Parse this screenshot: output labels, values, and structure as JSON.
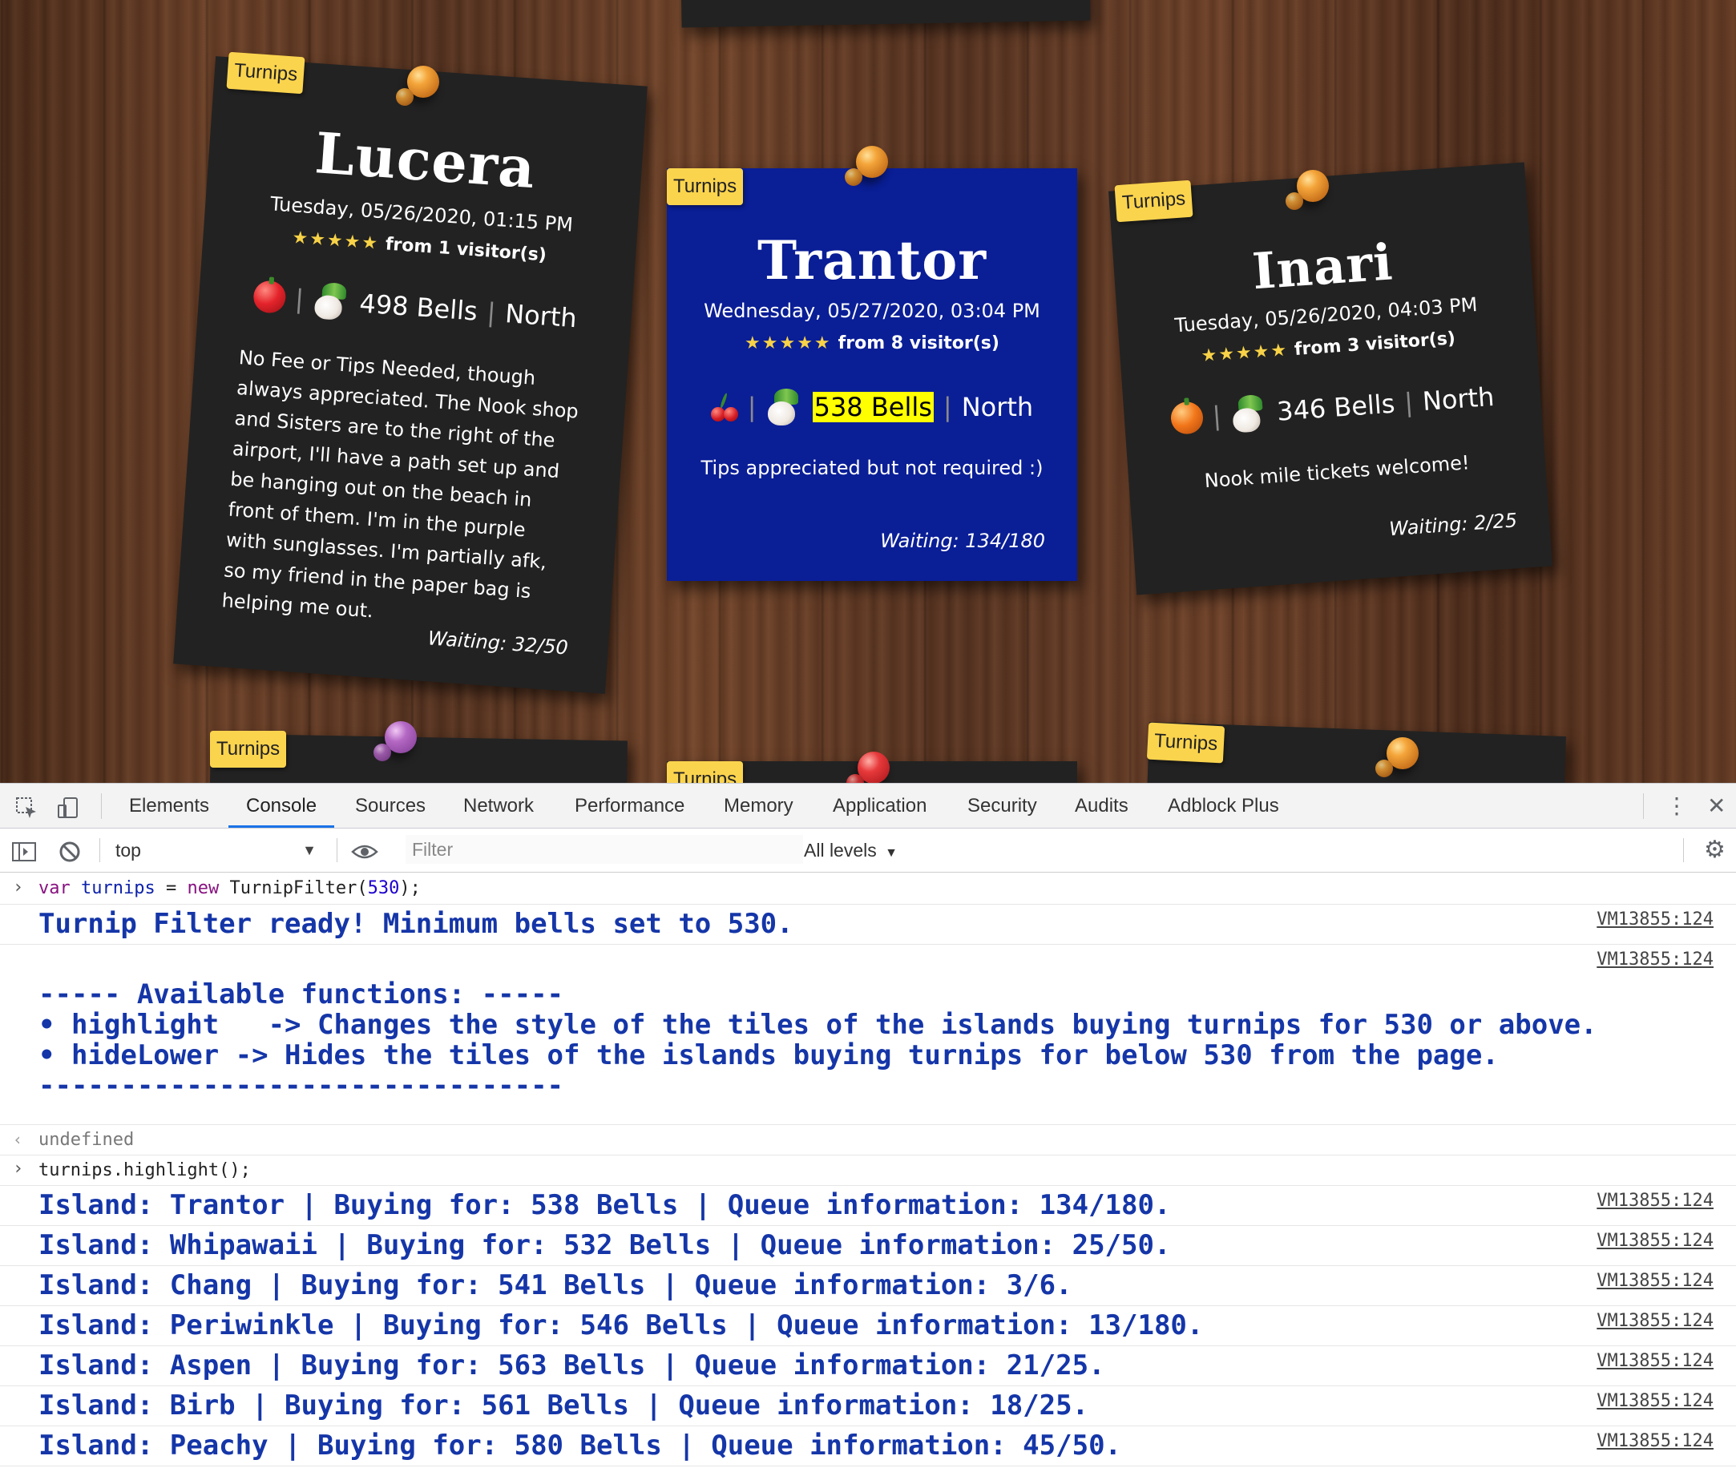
{
  "board": {
    "tiles": [
      {
        "tag": "Turnips",
        "name": "Lucera",
        "datetime": "Tuesday, 05/26/2020, 01:15 PM",
        "stars": "★★★★★",
        "visitors": "from 1 visitor(s)",
        "fruit": "apple",
        "bells": "498 Bells",
        "direction": "North",
        "description": "No Fee or Tips Needed, though always appreciated. The Nook shop and Sisters are to the right of the airport, I'll have a path set up and be hanging out on the beach in front of them. I'm in the purple with sunglasses. I'm partially afk, so my friend in the paper bag is helping me out.",
        "waiting": "Waiting: 32/50"
      },
      {
        "tag": "Turnips",
        "name": "Trantor",
        "datetime": "Wednesday, 05/27/2020, 03:04 PM",
        "stars": "★★★★★",
        "visitors": "from 8 visitor(s)",
        "fruit": "cherry",
        "bells": "538 Bells",
        "direction": "North",
        "description": "Tips appreciated but not required :)",
        "waiting": "Waiting: 134/180",
        "highlighted": true
      },
      {
        "tag": "Turnips",
        "name": "Inari",
        "datetime": "Tuesday, 05/26/2020, 04:03 PM",
        "stars": "★★★★★",
        "visitors": "from 3 visitor(s)",
        "fruit": "orange",
        "bells": "346 Bells",
        "direction": "North",
        "description": "Nook mile tickets welcome!",
        "waiting": "Waiting: 2/25"
      }
    ],
    "lower_tags": [
      "Turnips",
      "Turnips",
      "Turnips"
    ]
  },
  "devtools": {
    "tabs": [
      "Elements",
      "Console",
      "Sources",
      "Network",
      "Performance",
      "Memory",
      "Application",
      "Security",
      "Audits",
      "Adblock Plus"
    ],
    "active_tab": "Console",
    "context": "top",
    "filter_placeholder": "Filter",
    "levels": "All levels",
    "icons": {
      "inspect": "inspect-element-icon",
      "device": "device-toggle-icon",
      "more": "more-vertical-icon",
      "close": "close-icon",
      "sidebar": "sidebar-toggle-icon",
      "clear": "clear-console-icon",
      "eye": "live-expression-eye-icon",
      "settings": "gear-icon"
    }
  },
  "console": {
    "cmd1": "turnips = new TurnipFilter(530);",
    "cmd1_kw1": "var",
    "cmd1_kw2": "new",
    "ready": "Turnip Filter ready! Minimum bells set to 530.",
    "functions_header": "----- Available functions: -----",
    "func1": "• highlight   -> Changes the style of the tiles of the islands buying turnips for 530 or above.",
    "func2": "• hideLower -> Hides the tiles of the islands buying turnips for below 530 from the page.",
    "functions_footer": "--------------------------------",
    "undefined": "undefined",
    "cmd2": "turnips.highlight();",
    "source": "VM13855:124",
    "results": [
      "Island: Trantor | Buying for: 538 Bells | Queue information: 134/180.",
      "Island: Whipawaii | Buying for: 532 Bells | Queue information: 25/50.",
      "Island: Chang | Buying for: 541 Bells | Queue information: 3/6.",
      "Island: Periwinkle | Buying for: 546 Bells | Queue information: 13/180.",
      "Island: Aspen | Buying for: 563 Bells | Queue information: 21/25.",
      "Island: Birb | Buying for: 561 Bells | Queue information: 18/25.",
      "Island: Peachy | Buying for: 580 Bells | Queue information: 45/50."
    ]
  }
}
